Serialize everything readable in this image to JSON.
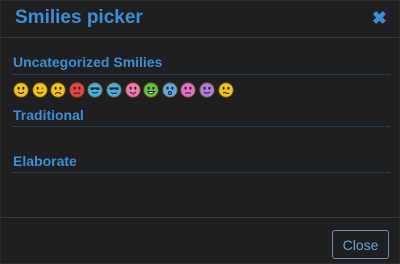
{
  "dialog": {
    "title": "Smilies picker",
    "close_icon": "✖",
    "close_button_label": "Close"
  },
  "sections": [
    {
      "title": "Uncategorized Smilies"
    },
    {
      "title": "Traditional"
    },
    {
      "title": "Elaborate"
    }
  ],
  "smilies": [
    {
      "icon": "smile-icon",
      "color": "#f2c31b"
    },
    {
      "icon": "wink-icon",
      "color": "#f2c31b"
    },
    {
      "icon": "frown-icon",
      "color": "#f2c31b"
    },
    {
      "icon": "angry-icon",
      "color": "#e8434a"
    },
    {
      "icon": "cool-icon",
      "color": "#3fb3e6"
    },
    {
      "icon": "sunglasses-icon",
      "color": "#3fb3e6"
    },
    {
      "icon": "tongue-icon",
      "color": "#f07ab5"
    },
    {
      "icon": "grin-icon",
      "color": "#5dc34e"
    },
    {
      "icon": "shocked-icon",
      "color": "#5aa6e8"
    },
    {
      "icon": "dizzy-icon",
      "color": "#e36fcf"
    },
    {
      "icon": "evil-icon",
      "color": "#b07be6"
    },
    {
      "icon": "confused-icon",
      "color": "#f2c31b"
    }
  ]
}
